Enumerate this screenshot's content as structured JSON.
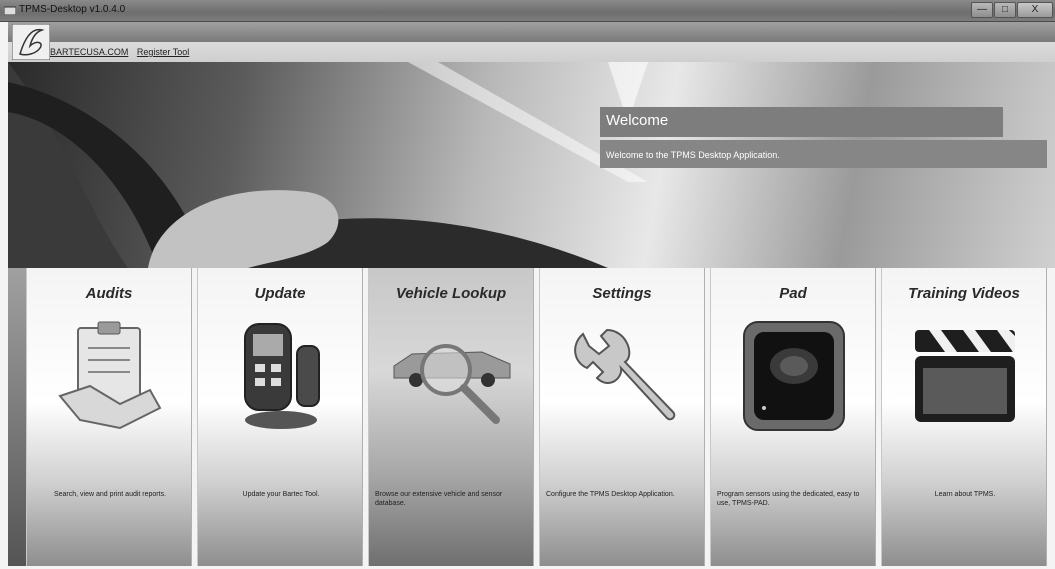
{
  "window": {
    "title": "TPMS-Desktop v1.0.4.0",
    "minimize": "—",
    "maximize": "□",
    "close": "X"
  },
  "header": {
    "links": [
      "BARTECUSA.COM",
      "Register Tool"
    ]
  },
  "hero": {
    "heading": "Welcome",
    "subtext": "Welcome to the TPMS Desktop Application."
  },
  "tiles": [
    {
      "title": "Audits",
      "description": "Search, view and print audit reports.",
      "icon": "clipboard-handshake-icon"
    },
    {
      "title": "Update",
      "description": "Update your Bartec Tool.",
      "icon": "tpms-tool-icon"
    },
    {
      "title": "Vehicle Lookup",
      "description": "Browse our extensive vehicle and sensor database.",
      "icon": "car-magnifier-icon"
    },
    {
      "title": "Settings",
      "description": "Configure the TPMS Desktop Application.",
      "icon": "wrench-icon"
    },
    {
      "title": "Pad",
      "description": "Program sensors using the dedicated, easy to use, TPMS-PAD.",
      "icon": "tpms-pad-icon"
    },
    {
      "title": "Training Videos",
      "description": "Learn about TPMS.",
      "icon": "clapperboard-icon"
    }
  ],
  "active_tile": "Vehicle Lookup",
  "logo_text": "B"
}
